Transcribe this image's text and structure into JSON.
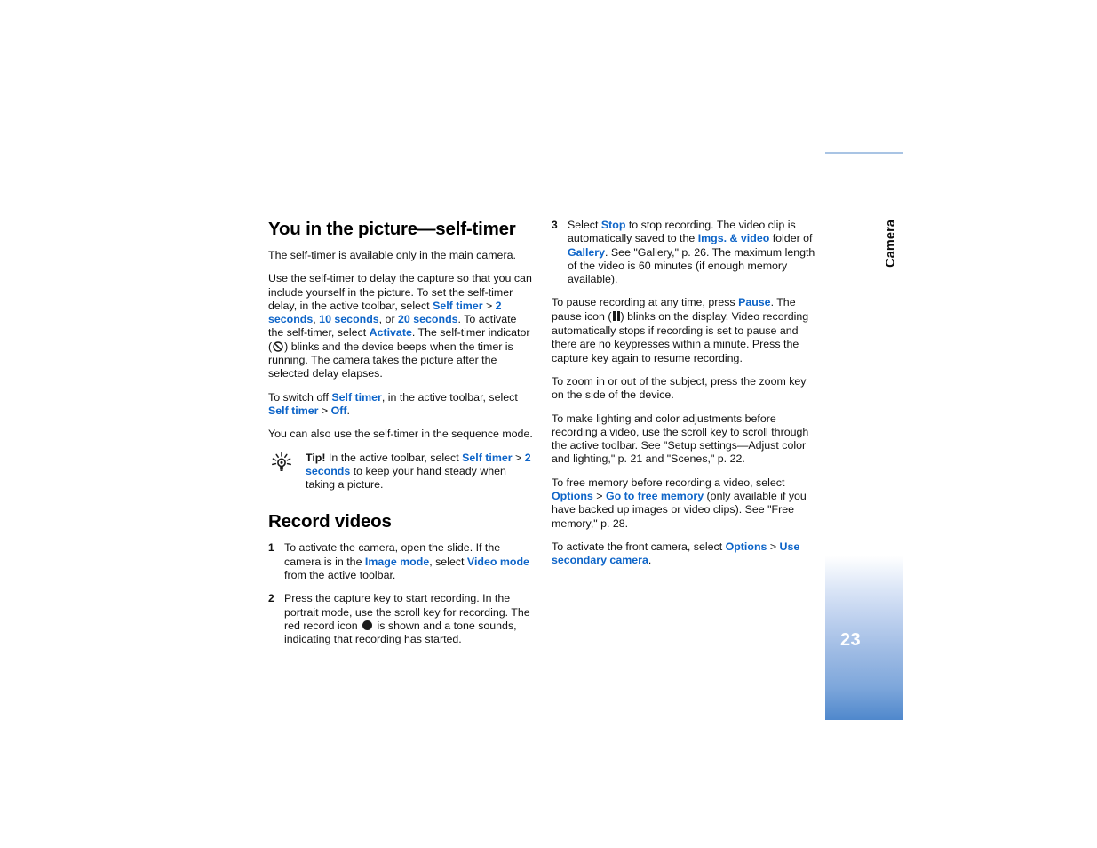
{
  "page": {
    "number": "23",
    "chapter_label": "Camera"
  },
  "left_column": {
    "title": "You in the picture—self-timer",
    "paragraph_1": "The self-timer is available only in the main camera.",
    "paragraph_2": {
      "t1": "Use the self-timer to delay the capture so that you can include yourself in the picture. To set the self-timer delay, in the active toolbar, select ",
      "ui1": "Self timer",
      "t2": " > ",
      "ui2": "2 seconds",
      "t3": ", ",
      "ui3": "10 seconds",
      "t4": ", or ",
      "ui4": "20 seconds",
      "t5": ". To activate the self-timer, select ",
      "ui5": "Activate",
      "t6": ". The self-timer indicator (",
      "t7": ") blinks and the device beeps when the timer is running. The camera takes the picture after the selected delay elapses."
    },
    "paragraph_3": {
      "t1": "To switch off ",
      "ui1": "Self timer",
      "t2": ", in the active toolbar, select ",
      "ui2": "Self timer",
      "t3": " > ",
      "ui3": "Off",
      "t4": "."
    },
    "paragraph_4": "You can also use the self-timer in the sequence mode.",
    "tip": {
      "label": "Tip!",
      "t1": " In the active toolbar, select ",
      "ui1": "Self timer",
      "t2": " > ",
      "ui2": "2 seconds",
      "t3": " to keep your hand steady when taking a picture."
    },
    "title_2": "Record videos",
    "steps": [
      {
        "num": "1",
        "t1": "To activate the camera, open the slide. If the camera is in the ",
        "ui1": "Image mode",
        "t2": ", select ",
        "ui2": "Video mode",
        "t3": " from the active toolbar."
      },
      {
        "num": "2",
        "t1": "Press the capture key to start recording. In the portrait mode, use the scroll key for recording. The red record icon ",
        "t2": " is shown and a tone sounds, indicating that recording has started."
      }
    ]
  },
  "right_column": {
    "step_3": {
      "num": "3",
      "t1": "Select ",
      "ui1": "Stop",
      "t2": " to stop recording. The video clip is automatically saved to the ",
      "ui2": "Imgs. & video",
      "t3": " folder of ",
      "ui3": "Gallery",
      "t4": ". See \"Gallery,\" p. 26. The maximum length of the video is 60 minutes (if enough memory available)."
    },
    "paragraph_pause": {
      "t1": "To pause recording at any time, press ",
      "ui1": "Pause",
      "t2": ". The pause icon (",
      "t3": ") blinks on the display. Video recording automatically stops if recording is set to pause and there are no keypresses within a minute. Press the capture key again to resume recording."
    },
    "paragraph_zoom": "To zoom in or out of the subject, press the zoom key on the side of the device.",
    "paragraph_lighting": "To make lighting and color adjustments before recording a video, use the scroll key to scroll through the active toolbar. See \"Setup settings—Adjust color and lighting,\" p. 21 and \"Scenes,\" p. 22.",
    "paragraph_memory": {
      "t1": "To free memory before recording a video, select ",
      "ui1": "Options",
      "t2": " > ",
      "ui2": "Go to free memory",
      "t3": " (only available if you have backed up images or video clips). See \"Free memory,\" p. 28."
    },
    "paragraph_front_camera": {
      "t1": "To activate the front camera, select ",
      "ui1": "Options",
      "t2": " > ",
      "ui2": "Use secondary camera",
      "t3": "."
    }
  },
  "icons": {
    "tip": "lightbulb-icon",
    "self_timer": "self-timer-indicator-icon",
    "record": "record-dot-icon",
    "pause": "pause-bars-icon"
  },
  "colors": {
    "ui_term": "#0d64c8",
    "tab_blue": "#2470bf",
    "tab_border": "#a9c4e4",
    "text": "#111111"
  }
}
